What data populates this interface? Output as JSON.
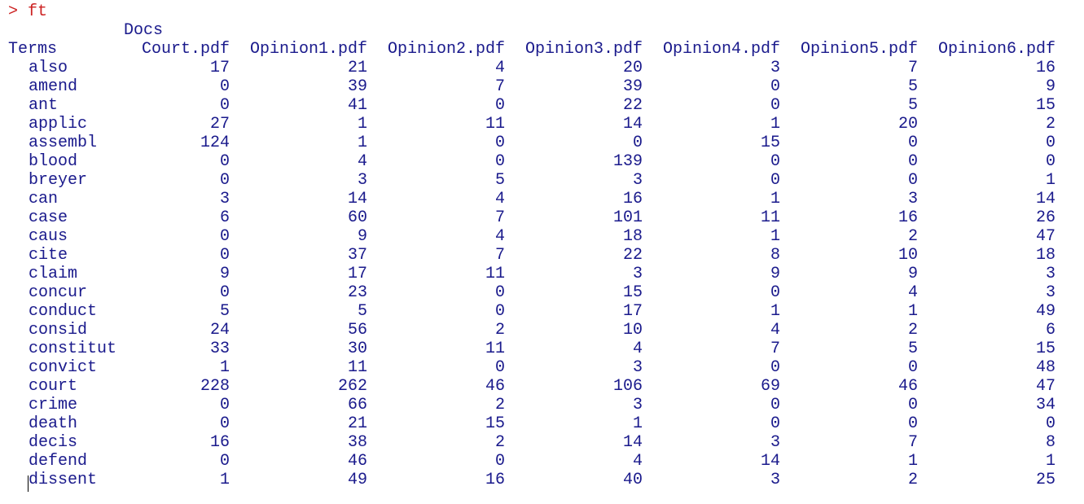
{
  "console": {
    "prompt": ">",
    "command": "ft",
    "docs_label": "Docs",
    "terms_label": "Terms",
    "columns": [
      "Court.pdf",
      "Opinion1.pdf",
      "Opinion2.pdf",
      "Opinion3.pdf",
      "Opinion4.pdf",
      "Opinion5.pdf",
      "Opinion6.pdf"
    ],
    "rows": [
      {
        "term": "also",
        "values": [
          "17",
          "21",
          "4",
          "20",
          "3",
          "7",
          "16"
        ]
      },
      {
        "term": "amend",
        "values": [
          "0",
          "39",
          "7",
          "39",
          "0",
          "5",
          "9"
        ]
      },
      {
        "term": "ant",
        "values": [
          "0",
          "41",
          "0",
          "22",
          "0",
          "5",
          "15"
        ]
      },
      {
        "term": "applic",
        "values": [
          "27",
          "1",
          "11",
          "14",
          "1",
          "20",
          "2"
        ]
      },
      {
        "term": "assembl",
        "values": [
          "124",
          "1",
          "0",
          "0",
          "15",
          "0",
          "0"
        ]
      },
      {
        "term": "blood",
        "values": [
          "0",
          "4",
          "0",
          "139",
          "0",
          "0",
          "0"
        ]
      },
      {
        "term": "breyer",
        "values": [
          "0",
          "3",
          "5",
          "3",
          "0",
          "0",
          "1"
        ]
      },
      {
        "term": "can",
        "values": [
          "3",
          "14",
          "4",
          "16",
          "1",
          "3",
          "14"
        ]
      },
      {
        "term": "case",
        "values": [
          "6",
          "60",
          "7",
          "101",
          "11",
          "16",
          "26"
        ]
      },
      {
        "term": "caus",
        "values": [
          "0",
          "9",
          "4",
          "18",
          "1",
          "2",
          "47"
        ]
      },
      {
        "term": "cite",
        "values": [
          "0",
          "37",
          "7",
          "22",
          "8",
          "10",
          "18"
        ]
      },
      {
        "term": "claim",
        "values": [
          "9",
          "17",
          "11",
          "3",
          "9",
          "9",
          "3"
        ]
      },
      {
        "term": "concur",
        "values": [
          "0",
          "23",
          "0",
          "15",
          "0",
          "4",
          "3"
        ]
      },
      {
        "term": "conduct",
        "values": [
          "5",
          "5",
          "0",
          "17",
          "1",
          "1",
          "49"
        ]
      },
      {
        "term": "consid",
        "values": [
          "24",
          "56",
          "2",
          "10",
          "4",
          "2",
          "6"
        ]
      },
      {
        "term": "constitut",
        "values": [
          "33",
          "30",
          "11",
          "4",
          "7",
          "5",
          "15"
        ]
      },
      {
        "term": "convict",
        "values": [
          "1",
          "11",
          "0",
          "3",
          "0",
          "0",
          "48"
        ]
      },
      {
        "term": "court",
        "values": [
          "228",
          "262",
          "46",
          "106",
          "69",
          "46",
          "47"
        ]
      },
      {
        "term": "crime",
        "values": [
          "0",
          "66",
          "2",
          "3",
          "0",
          "0",
          "34"
        ]
      },
      {
        "term": "death",
        "values": [
          "0",
          "21",
          "15",
          "1",
          "0",
          "0",
          "0"
        ]
      },
      {
        "term": "decis",
        "values": [
          "16",
          "38",
          "2",
          "14",
          "3",
          "7",
          "8"
        ]
      },
      {
        "term": "defend",
        "values": [
          "0",
          "46",
          "0",
          "4",
          "14",
          "1",
          "1"
        ]
      },
      {
        "term": "dissent",
        "values": [
          "1",
          "49",
          "16",
          "40",
          "3",
          "2",
          "25"
        ]
      }
    ]
  },
  "colors": {
    "output_text": "#1a1a8c",
    "prompt": "#cc2222",
    "background": "#ffffff"
  }
}
